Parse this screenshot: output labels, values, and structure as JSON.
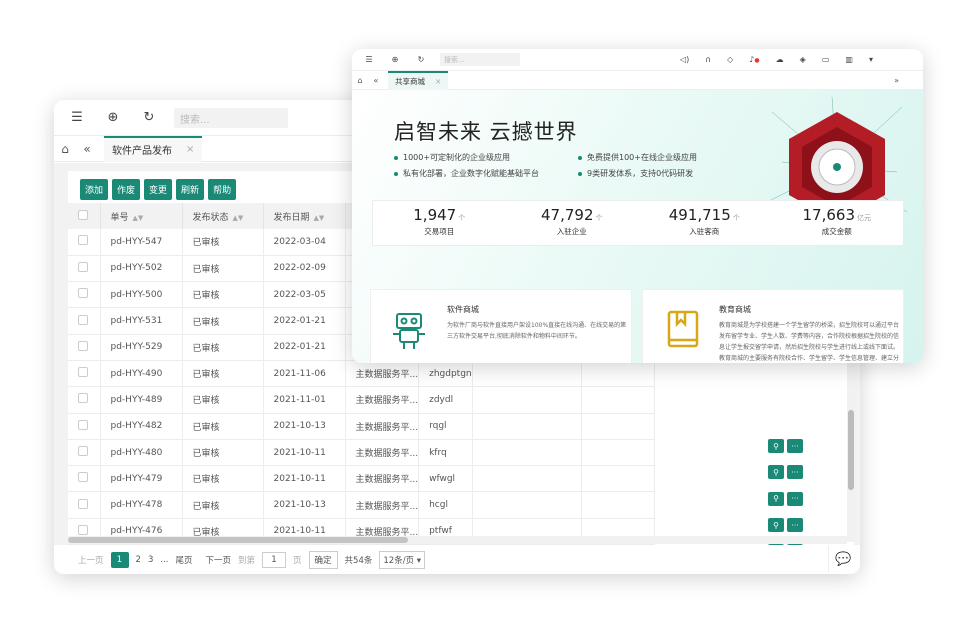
{
  "back_window": {
    "toolbar": {
      "search_placeholder": "搜索..."
    },
    "tab": {
      "label": "软件产品发布"
    },
    "buttons": [
      "添加",
      "作废",
      "变更",
      "刷新",
      "帮助"
    ],
    "table": {
      "headers": [
        "单号",
        "发布状态",
        "发布日期"
      ],
      "rows": [
        [
          "pd-HYY-547",
          "已审核",
          "2022-03-04",
          "",
          ""
        ],
        [
          "pd-HYY-502",
          "已审核",
          "2022-02-09",
          "",
          ""
        ],
        [
          "pd-HYY-500",
          "已审核",
          "2022-03-05",
          "",
          ""
        ],
        [
          "pd-HYY-531",
          "已审核",
          "2022-01-21",
          "",
          ""
        ],
        [
          "pd-HYY-529",
          "已审核",
          "2022-01-21",
          "",
          ""
        ],
        [
          "pd-HYY-490",
          "已审核",
          "2021-11-06",
          "主数据服务平...",
          "zhgdptgn"
        ],
        [
          "pd-HYY-489",
          "已审核",
          "2021-11-01",
          "主数据服务平...",
          "zdydl"
        ],
        [
          "pd-HYY-482",
          "已审核",
          "2021-10-13",
          "主数据服务平...",
          "rqgl"
        ],
        [
          "pd-HYY-480",
          "已审核",
          "2021-10-11",
          "主数据服务平...",
          "kfrq"
        ],
        [
          "pd-HYY-479",
          "已审核",
          "2021-10-11",
          "主数据服务平...",
          "wfwgl"
        ],
        [
          "pd-HYY-478",
          "已审核",
          "2021-10-13",
          "主数据服务平...",
          "hcgl"
        ],
        [
          "pd-HYY-476",
          "已审核",
          "2021-10-11",
          "主数据服务平...",
          "ptfwf"
        ]
      ]
    },
    "pager": {
      "prev": "上一页",
      "pages": [
        "1",
        "2",
        "3",
        "..."
      ],
      "last": "尾页",
      "next": "下一页",
      "goto": "到第",
      "page_value": "1",
      "page_unit": "页",
      "confirm": "确定",
      "total": "共54条",
      "per_page": "12条/页"
    }
  },
  "front_window": {
    "toolbar": {
      "search_placeholder": "搜索..."
    },
    "tab": {
      "label": "共享商城"
    },
    "hero": {
      "title": "启智未来  云撼世界",
      "bullets": [
        "1000+可定制化的企业级应用",
        "免费提供100+在线企业级应用",
        "私有化部署，企业数字化赋能基础平台",
        "9类研发体系，支持0代码研发"
      ]
    },
    "stats": [
      {
        "value": "1,947",
        "unit": "个",
        "label": "交易项目"
      },
      {
        "value": "47,792",
        "unit": "个",
        "label": "入驻企业"
      },
      {
        "value": "491,715",
        "unit": "个",
        "label": "入驻客商"
      },
      {
        "value": "17,663",
        "unit": "亿元",
        "label": "成交金额"
      }
    ],
    "features": [
      {
        "title": "软件商城",
        "desc": "为软件厂商与软件直接用户架设100%直接在线沟通、在线交易的第三方软件交易平台,彻底消除软件和物料中间环节。"
      },
      {
        "title": "教育商城",
        "desc": "教育商城是为学校搭建一个学生留学的桥梁，招生院校可以通过平台发布留学专业、学生人数、学费等内容，合作院校根据招生院校的信息让学生报交留学申请，然后招生院校与学生进行线上或线下面试。教育商城的主要服务有院校合作、学生留学、学生信息管理、建立分校、学生兼职、二手交易等。"
      }
    ]
  }
}
